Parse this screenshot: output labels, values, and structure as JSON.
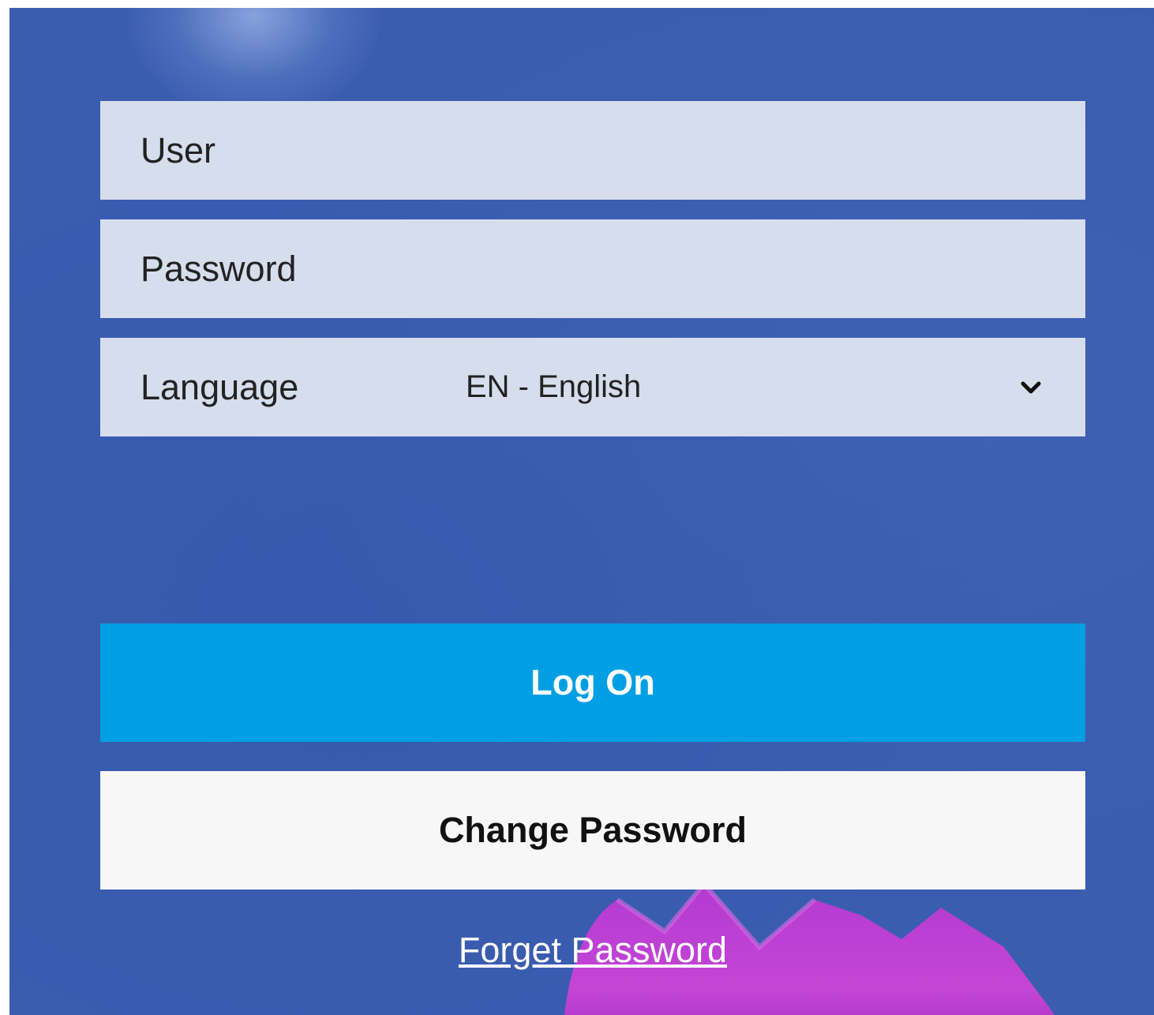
{
  "form": {
    "user_label": "User",
    "password_label": "Password",
    "language_label": "Language",
    "language_value": "EN - English"
  },
  "buttons": {
    "log_on": "Log On",
    "change_password": "Change Password"
  },
  "links": {
    "forget_password": "Forget Password"
  },
  "colors": {
    "background": "#3b5db0",
    "field_bg": "#d6deed",
    "primary_button": "#009fe3",
    "secondary_button": "#f7f7f7",
    "flower": "#c13fd0"
  },
  "icons": {
    "dropdown": "chevron-down-icon"
  }
}
